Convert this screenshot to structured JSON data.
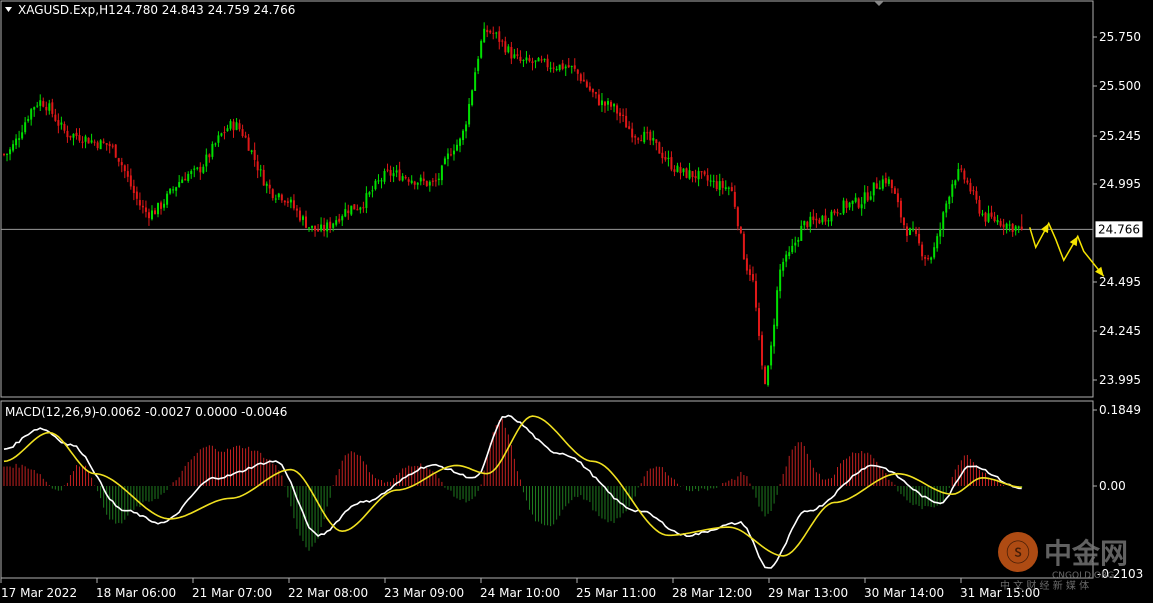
{
  "header": {
    "symbol_label": "XAGUSD.Exp,H1",
    "ohlc": "24.780 24.843 24.759 24.766"
  },
  "macd_header": {
    "label": "MACD(12,26,9)",
    "values": "-0.0062 -0.0027 0.0000 -0.0046"
  },
  "price_scale": {
    "ticks": [
      "25.750",
      "25.500",
      "25.245",
      "24.995",
      "24.766",
      "24.495",
      "24.245",
      "23.995"
    ],
    "current_price": "24.766"
  },
  "macd_scale": {
    "ticks": [
      "0.1849",
      "0.00",
      "-0.2103"
    ]
  },
  "time_axis": {
    "labels": [
      "17 Mar 2022",
      "18 Mar 06:00",
      "21 Mar 07:00",
      "22 Mar 08:00",
      "23 Mar 09:00",
      "24 Mar 10:00",
      "25 Mar 11:00",
      "28 Mar 12:00",
      "29 Mar 13:00",
      "30 Mar 14:00",
      "31 Mar 15:00"
    ]
  },
  "watermark": {
    "brand": "中金网",
    "site": "CNGOLD.ORG",
    "tagline": "中 文 财 经 新 媒 体"
  },
  "colors": {
    "background": "#000000",
    "bull_candle": "#00e000",
    "bear_candle": "#e01818",
    "macd_line": "#ffffff",
    "signal_line": "#f0e020",
    "hist_positive": "#c02020",
    "hist_negative": "#1f7a1f",
    "current_price_line": "#9a9a9a",
    "forecast_arrows": "#f5e400"
  },
  "chart_data": [
    {
      "type": "candlestick",
      "title": "XAGUSD.Exp,H1",
      "timeframe": "H1",
      "ylim": [
        23.9,
        25.9
      ],
      "x_tick_labels": [
        "17 Mar 2022",
        "18 Mar 06:00",
        "21 Mar 07:00",
        "22 Mar 08:00",
        "23 Mar 09:00",
        "24 Mar 10:00",
        "25 Mar 11:00",
        "28 Mar 12:00",
        "29 Mar 13:00",
        "30 Mar 14:00",
        "31 Mar 15:00"
      ],
      "y_tick_labels": [
        "25.750",
        "25.500",
        "25.245",
        "24.995",
        "24.766",
        "24.495",
        "24.245",
        "23.995"
      ],
      "last_bar": {
        "open": 24.78,
        "high": 24.843,
        "low": 24.759,
        "close": 24.766
      },
      "current_price": 24.766,
      "close_path_keypoints": [
        {
          "bar": 0,
          "close": 25.15
        },
        {
          "bar": 12,
          "close": 25.42
        },
        {
          "bar": 22,
          "close": 25.25
        },
        {
          "bar": 34,
          "close": 25.2
        },
        {
          "bar": 48,
          "close": 24.85
        },
        {
          "bar": 62,
          "close": 25.05
        },
        {
          "bar": 76,
          "close": 25.3
        },
        {
          "bar": 90,
          "close": 24.95
        },
        {
          "bar": 104,
          "close": 24.76
        },
        {
          "bar": 116,
          "close": 24.88
        },
        {
          "bar": 128,
          "close": 25.05
        },
        {
          "bar": 142,
          "close": 25.0
        },
        {
          "bar": 150,
          "close": 25.2
        },
        {
          "bar": 160,
          "close": 25.78
        },
        {
          "bar": 172,
          "close": 25.62
        },
        {
          "bar": 186,
          "close": 25.6
        },
        {
          "bar": 200,
          "close": 25.4
        },
        {
          "bar": 210,
          "close": 25.25
        },
        {
          "bar": 226,
          "close": 25.05
        },
        {
          "bar": 240,
          "close": 24.98
        },
        {
          "bar": 247,
          "close": 24.55
        },
        {
          "bar": 252,
          "close": 24.0
        },
        {
          "bar": 258,
          "close": 24.6
        },
        {
          "bar": 266,
          "close": 24.8
        },
        {
          "bar": 282,
          "close": 24.9
        },
        {
          "bar": 292,
          "close": 25.02
        },
        {
          "bar": 300,
          "close": 24.75
        },
        {
          "bar": 306,
          "close": 24.62
        },
        {
          "bar": 316,
          "close": 25.05
        },
        {
          "bar": 326,
          "close": 24.82
        },
        {
          "bar": 337,
          "close": 24.77
        }
      ],
      "forecast_arrows": 3
    },
    {
      "type": "macd",
      "label": "MACD(12,26,9)",
      "params": [
        12,
        26,
        9
      ],
      "values": [
        -0.0062,
        -0.0027,
        0.0,
        -0.0046
      ],
      "ylim": [
        -0.2103,
        0.1849
      ],
      "y_tick_labels": [
        "0.1849",
        "0.00",
        "-0.2103"
      ],
      "macd_line_keypoints": [
        {
          "bar": 0,
          "value": 0.09
        },
        {
          "bar": 12,
          "value": 0.14
        },
        {
          "bar": 22,
          "value": 0.1
        },
        {
          "bar": 40,
          "value": -0.06
        },
        {
          "bar": 52,
          "value": -0.09
        },
        {
          "bar": 70,
          "value": 0.02
        },
        {
          "bar": 90,
          "value": 0.06
        },
        {
          "bar": 104,
          "value": -0.12
        },
        {
          "bar": 118,
          "value": -0.04
        },
        {
          "bar": 142,
          "value": 0.05
        },
        {
          "bar": 156,
          "value": 0.02
        },
        {
          "bar": 166,
          "value": 0.17
        },
        {
          "bar": 184,
          "value": 0.08
        },
        {
          "bar": 210,
          "value": -0.06
        },
        {
          "bar": 226,
          "value": -0.12
        },
        {
          "bar": 244,
          "value": -0.09
        },
        {
          "bar": 253,
          "value": -0.2
        },
        {
          "bar": 266,
          "value": -0.06
        },
        {
          "bar": 288,
          "value": 0.05
        },
        {
          "bar": 310,
          "value": -0.04
        },
        {
          "bar": 320,
          "value": 0.05
        },
        {
          "bar": 337,
          "value": -0.006
        }
      ],
      "signal_line_keypoints": [
        {
          "bar": 0,
          "value": 0.06
        },
        {
          "bar": 15,
          "value": 0.13
        },
        {
          "bar": 30,
          "value": 0.03
        },
        {
          "bar": 55,
          "value": -0.08
        },
        {
          "bar": 75,
          "value": -0.03
        },
        {
          "bar": 95,
          "value": 0.04
        },
        {
          "bar": 112,
          "value": -0.11
        },
        {
          "bar": 130,
          "value": -0.01
        },
        {
          "bar": 150,
          "value": 0.05
        },
        {
          "bar": 160,
          "value": 0.03
        },
        {
          "bar": 175,
          "value": 0.17
        },
        {
          "bar": 195,
          "value": 0.06
        },
        {
          "bar": 220,
          "value": -0.12
        },
        {
          "bar": 240,
          "value": -0.1
        },
        {
          "bar": 258,
          "value": -0.17
        },
        {
          "bar": 275,
          "value": -0.04
        },
        {
          "bar": 296,
          "value": 0.03
        },
        {
          "bar": 314,
          "value": -0.02
        },
        {
          "bar": 324,
          "value": 0.02
        },
        {
          "bar": 337,
          "value": -0.003
        }
      ]
    }
  ]
}
